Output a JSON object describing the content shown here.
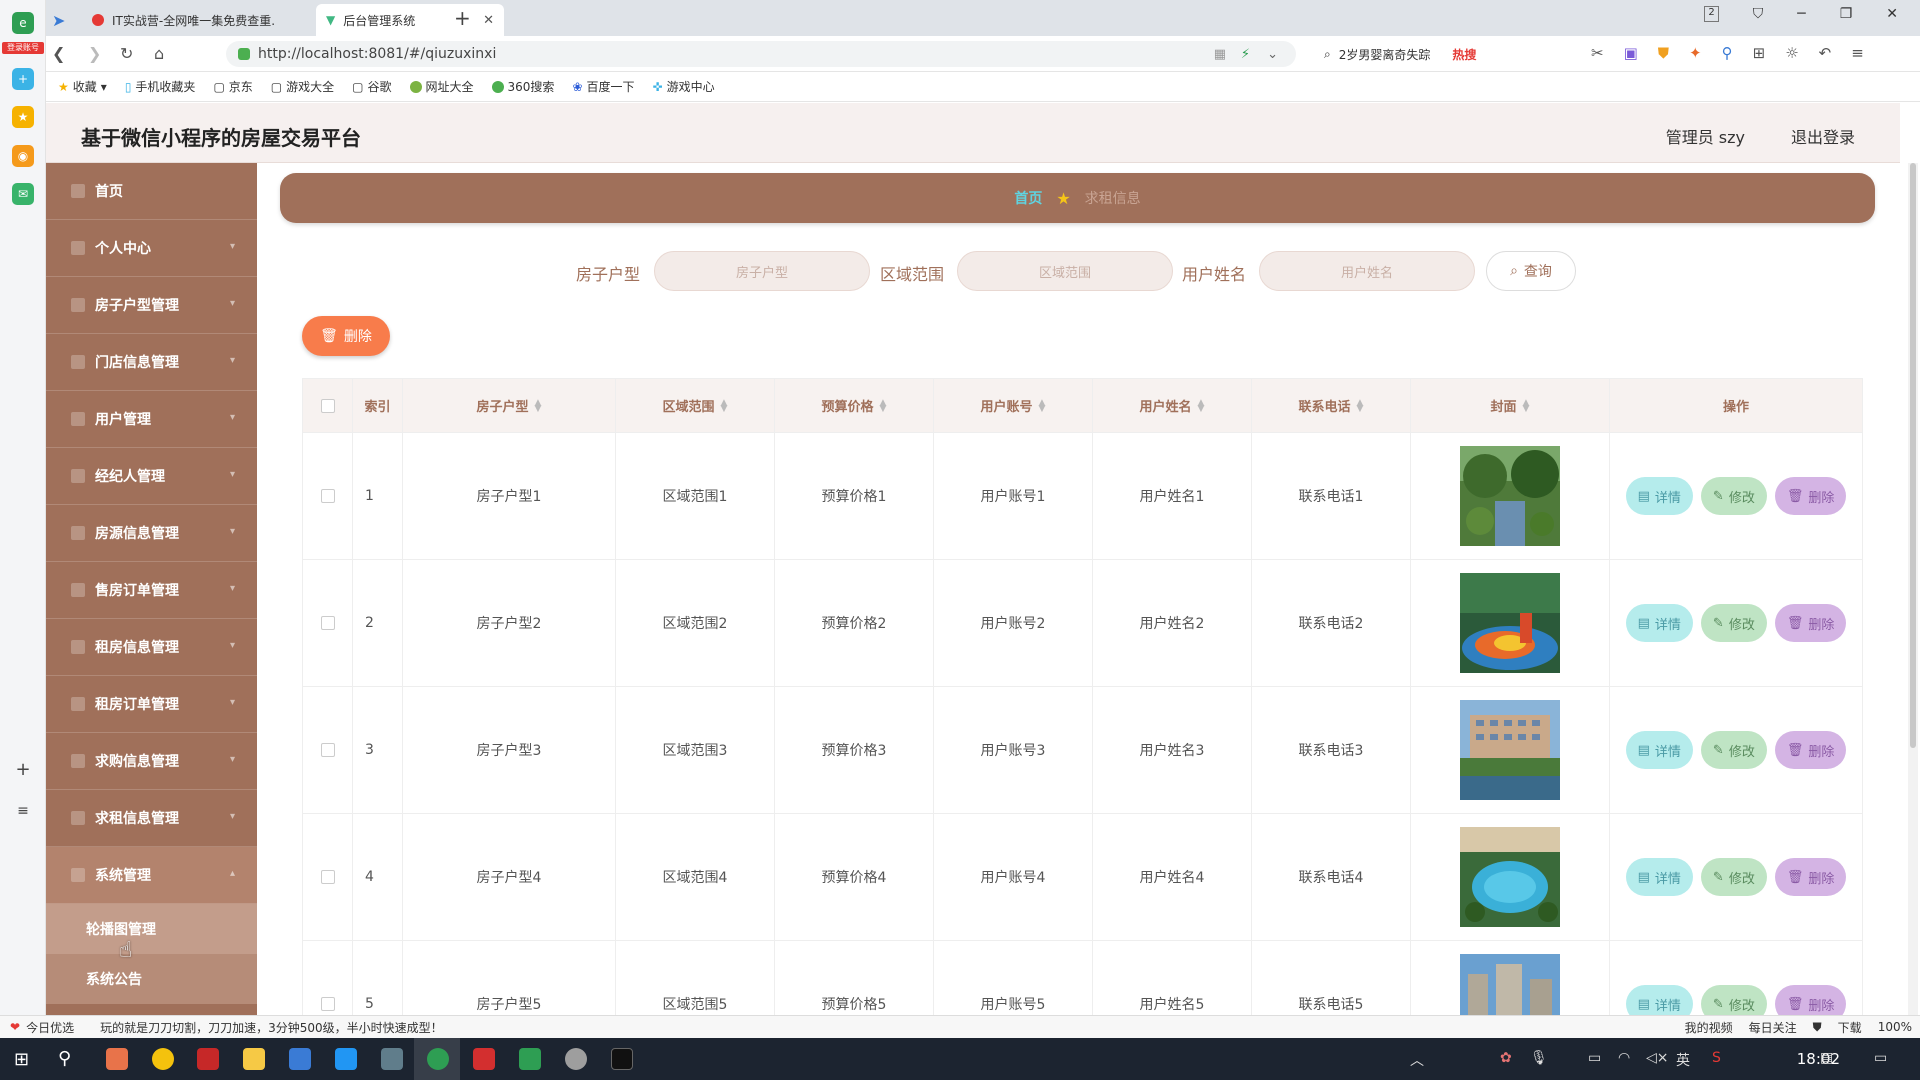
{
  "browser": {
    "tabs": [
      {
        "title": "IT实战营-全网唯一集免费查重."
      },
      {
        "title": "后台管理系统"
      }
    ],
    "url": "http://localhost:8081/#/qiuzuxinxi",
    "search_text": "2岁男婴离奇失踪",
    "search_hot": "热搜",
    "bookmarks": [
      "收藏",
      "手机收藏夹",
      "京东",
      "游戏大全",
      "谷歌",
      "网址大全",
      "360搜索",
      "百度一下",
      "游戏中心"
    ],
    "dock_badge": "登录账号",
    "tab_count": "2"
  },
  "app": {
    "title": "基于微信小程序的房屋交易平台",
    "admin": "管理员 szy",
    "logout": "退出登录"
  },
  "sidebar": {
    "items": [
      {
        "label": "首页",
        "has_arrow": false
      },
      {
        "label": "个人中心",
        "has_arrow": true
      },
      {
        "label": "房子户型管理",
        "has_arrow": true
      },
      {
        "label": "门店信息管理",
        "has_arrow": true
      },
      {
        "label": "用户管理",
        "has_arrow": true
      },
      {
        "label": "经纪人管理",
        "has_arrow": true
      },
      {
        "label": "房源信息管理",
        "has_arrow": true
      },
      {
        "label": "售房订单管理",
        "has_arrow": true
      },
      {
        "label": "租房信息管理",
        "has_arrow": true
      },
      {
        "label": "租房订单管理",
        "has_arrow": true
      },
      {
        "label": "求购信息管理",
        "has_arrow": true
      },
      {
        "label": "求租信息管理",
        "has_arrow": true
      },
      {
        "label": "系统管理",
        "has_arrow": true
      }
    ],
    "sub_items": [
      "轮播图管理",
      "系统公告"
    ]
  },
  "breadcrumb": {
    "home": "首页",
    "current": "求租信息"
  },
  "filters": {
    "fields": [
      {
        "label": "房子户型",
        "placeholder": "房子户型"
      },
      {
        "label": "区域范围",
        "placeholder": "区域范围"
      },
      {
        "label": "用户姓名",
        "placeholder": "用户姓名"
      }
    ],
    "query_label": "查询"
  },
  "delete_label": "删除",
  "table": {
    "headers": [
      "索引",
      "房子户型",
      "区域范围",
      "预算价格",
      "用户账号",
      "用户姓名",
      "联系电话",
      "封面",
      "操作"
    ],
    "rows": [
      {
        "index": "1",
        "huxing": "房子户型1",
        "quyu": "区域范围1",
        "jiage": "预算价格1",
        "zhanghao": "用户账号1",
        "xingming": "用户姓名1",
        "dianhua": "联系电话1",
        "cover": "garden"
      },
      {
        "index": "2",
        "huxing": "房子户型2",
        "quyu": "区域范围2",
        "jiage": "预算价格2",
        "zhanghao": "用户账号2",
        "xingming": "用户姓名2",
        "dianhua": "联系电话2",
        "cover": "playground"
      },
      {
        "index": "3",
        "huxing": "房子户型3",
        "quyu": "区域范围3",
        "jiage": "预算价格3",
        "zhanghao": "用户账号3",
        "xingming": "用户姓名3",
        "dianhua": "联系电话3",
        "cover": "pond"
      },
      {
        "index": "4",
        "huxing": "房子户型4",
        "quyu": "区域范围4",
        "jiage": "预算价格4",
        "zhanghao": "用户账号4",
        "xingming": "用户姓名4",
        "dianhua": "联系电话4",
        "cover": "pool"
      },
      {
        "index": "5",
        "huxing": "房子户型5",
        "quyu": "区域范围5",
        "jiage": "预算价格5",
        "zhanghao": "用户账号5",
        "xingming": "用户姓名5",
        "dianhua": "联系电话5",
        "cover": "towers"
      }
    ],
    "actions": {
      "detail": "详情",
      "edit": "修改",
      "delete": "删除"
    }
  },
  "statusbar": {
    "left_app": "今日优选",
    "ad_text": "玩的就是刀刀切割，刀刀加速，3分钟500级，半小时快速成型！",
    "right": [
      "我的视频",
      "每日关注",
      "下载",
      "100%"
    ]
  },
  "taskbar": {
    "time": "18:02",
    "lang": "英"
  },
  "colors": {
    "primary": "#a0705a",
    "accent": "#f87c4b",
    "crumb_home": "#5fd3e0"
  }
}
